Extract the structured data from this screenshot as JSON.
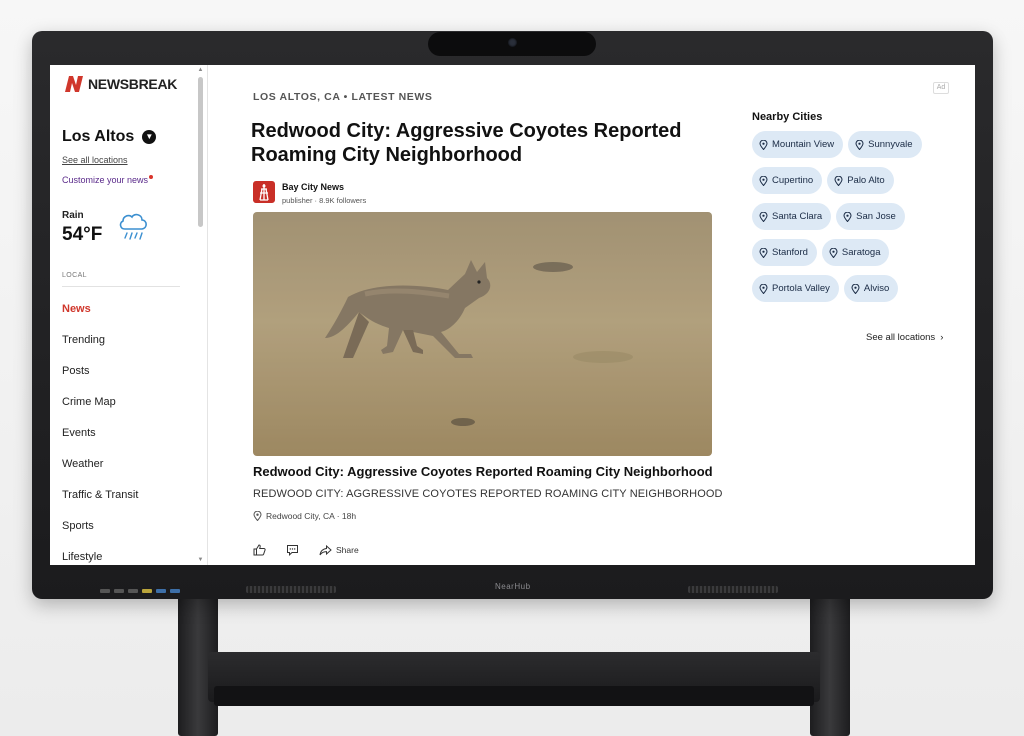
{
  "device": {
    "brand": "NearHub"
  },
  "site": {
    "logo_text": "NEWSBREAK",
    "ad_label": "Ad"
  },
  "sidebar": {
    "location": "Los Altos",
    "see_all_locations": "See all locations",
    "customize": "Customize your news",
    "weather": {
      "condition": "Rain",
      "temperature": "54°F",
      "icon": "rain-cloud-icon"
    },
    "section_label": "LOCAL",
    "nav": [
      {
        "label": "News",
        "active": true
      },
      {
        "label": "Trending"
      },
      {
        "label": "Posts"
      },
      {
        "label": "Crime Map"
      },
      {
        "label": "Events"
      },
      {
        "label": "Weather"
      },
      {
        "label": "Traffic & Transit"
      },
      {
        "label": "Sports"
      },
      {
        "label": "Lifestyle"
      }
    ]
  },
  "article": {
    "kicker": "LOS ALTOS, CA • LATEST NEWS",
    "headline": "Redwood City: Aggressive Coyotes Reported Roaming City Neighborhood",
    "publisher": {
      "name": "Bay City News",
      "meta": "publisher · 8.9K followers"
    },
    "caption_title": "Redwood City: Aggressive Coyotes Reported Roaming City Neighborhood",
    "caption_sub": "REDWOOD CITY: AGGRESSIVE COYOTES REPORTED ROAMING CITY NEIGHBORHOOD",
    "place": "Redwood City, CA · 18h",
    "actions": {
      "share": "Share"
    }
  },
  "nearby": {
    "title": "Nearby Cities",
    "cities": [
      "Mountain View",
      "Sunnyvale",
      "Cupertino",
      "Palo Alto",
      "Santa Clara",
      "San Jose",
      "Stanford",
      "Saratoga",
      "Portola Valley",
      "Alviso"
    ],
    "see_all": "See all locations"
  },
  "colors": {
    "accent": "#d0372c",
    "chip_bg": "#dde9f5",
    "link_purple": "#5a2a8a"
  }
}
